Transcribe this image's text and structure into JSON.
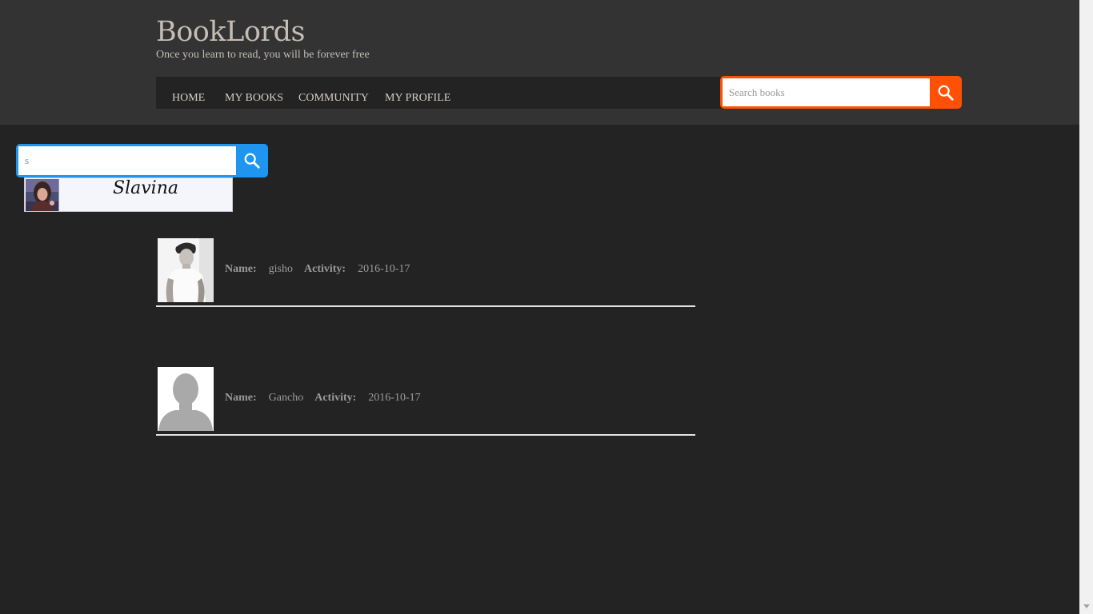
{
  "header": {
    "title": "BookLords",
    "tagline": "Once you learn to read, you will be forever free"
  },
  "nav": {
    "items": [
      {
        "label": "HOME"
      },
      {
        "label": "MY BOOKS"
      },
      {
        "label": "COMMUNITY"
      },
      {
        "label": "MY PROFILE"
      }
    ]
  },
  "book_search": {
    "placeholder": "Search books",
    "value": "",
    "icon": "search-icon",
    "accent": "#ff5106"
  },
  "user_search": {
    "value": "s",
    "icon": "search-icon",
    "accent": "#1e96f0",
    "suggestions": [
      {
        "name": "Slavina"
      }
    ]
  },
  "users": {
    "name_label": "Name:",
    "activity_label": "Activity:",
    "rows": [
      {
        "name": "gisho",
        "activity": "2016-10-17"
      },
      {
        "name": "Gancho",
        "activity": "2016-10-17"
      }
    ]
  }
}
